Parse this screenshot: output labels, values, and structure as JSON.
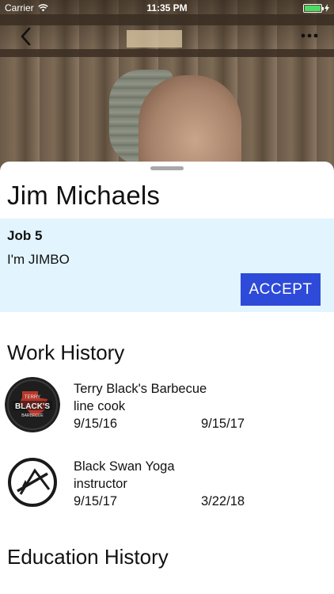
{
  "status_bar": {
    "carrier": "Carrier",
    "time": "11:35 PM",
    "battery_color": "#4cd964"
  },
  "nav": {
    "back_icon": "chevron-left-icon",
    "more_icon": "ellipsis-icon"
  },
  "profile": {
    "name": "Jim Michaels"
  },
  "job": {
    "title": "Job 5",
    "description": "I'm JIMBO",
    "accept_label": "ACCEPT",
    "card_color": "#e2f4fd",
    "button_color": "#2d4ad9"
  },
  "work_history": {
    "title": "Work History",
    "items": [
      {
        "company": "Terry Black's Barbecue",
        "role": "line cook",
        "start": "9/15/16",
        "end": "9/15/17",
        "logo_text": "TERRY BLACK'S BARBECUE"
      },
      {
        "company": "Black Swan Yoga",
        "role": "instructor",
        "start": "9/15/17",
        "end": "3/22/18"
      }
    ]
  },
  "education_history": {
    "title": "Education History"
  }
}
